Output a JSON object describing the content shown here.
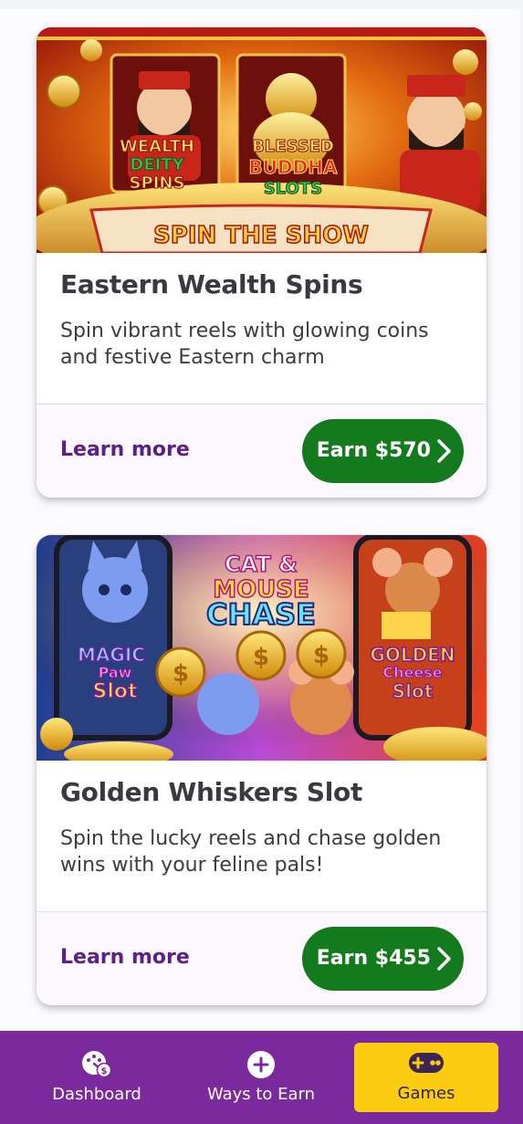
{
  "colors": {
    "brand_purple": "#7b2a9e",
    "learn_more": "#5b1f86",
    "earn_green": "#147a1e",
    "games_tab_yellow": "#fccc11"
  },
  "cards": [
    {
      "image_alt": "slot-art-eastern-wealth",
      "image_text": {
        "left_logo_1": "WEALTH",
        "left_logo_2": "DEITY",
        "left_logo_3": "SPINS",
        "center_logo_1": "BLESSED",
        "center_logo_2": "BUDDHA",
        "center_logo_3": "SLOTS",
        "banner": "SPIN THE SHOW"
      },
      "title": "Eastern Wealth Spins",
      "description": "Spin vibrant reels with glowing coins and festive Eastern charm",
      "learn_more": "Learn more",
      "earn_label": "Earn $570"
    },
    {
      "image_alt": "slot-art-golden-whiskers",
      "image_text": {
        "left_logo_1": "MAGIC",
        "left_logo_2": "Paw",
        "left_logo_3": "Slot",
        "center_logo_1": "CAT &",
        "center_logo_2": "MOUSE",
        "center_logo_3": "CHASE",
        "right_logo_1": "GOLDEN",
        "right_logo_2": "Cheese",
        "right_logo_3": "Slot"
      },
      "title": "Golden Whiskers Slot",
      "description": "Spin the lucky reels and chase golden wins with your feline pals!",
      "learn_more": "Learn more",
      "earn_label": "Earn $455"
    }
  ],
  "bottom_nav": {
    "items": [
      {
        "label": "Dashboard",
        "icon": "dashboard-gauge-icon",
        "selected": false
      },
      {
        "label": "Ways to Earn",
        "icon": "plus-circle-icon",
        "selected": false
      },
      {
        "label": "Games",
        "icon": "gamepad-icon",
        "selected": true
      }
    ]
  }
}
